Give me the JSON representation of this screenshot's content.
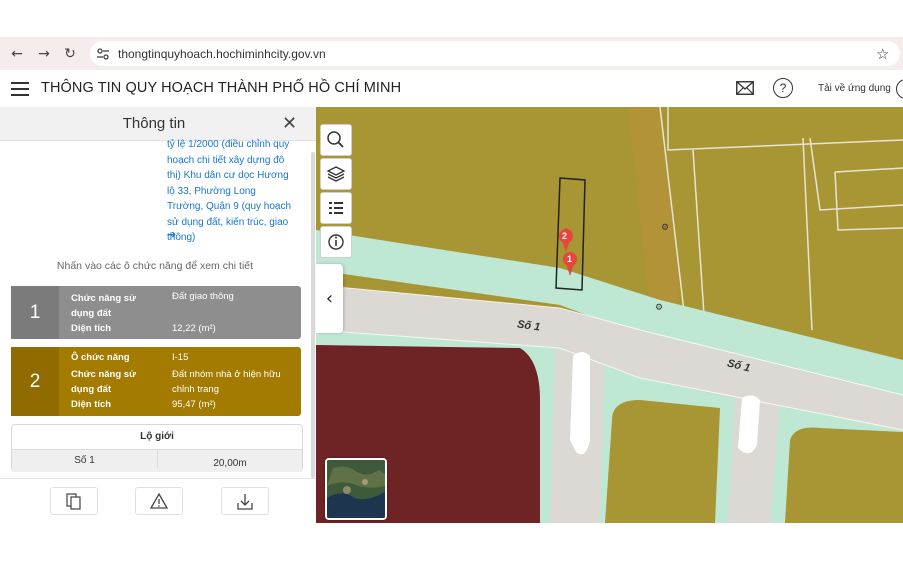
{
  "browser": {
    "url": "thongtinquyhoach.hochiminhcity.gov.vn"
  },
  "header": {
    "title": "THÔNG TIN QUY HOẠCH THÀNH PHỐ HỒ CHÍ MINH",
    "download_app": "Tải về ứng dụng"
  },
  "panel": {
    "title": "Thông tin",
    "plan_link": "tỷ lệ 1/2000 (điều chỉnh quy hoạch chi tiết xây dựng đô thị) Khu dân cư dọc Hương lộ 33, Phường Long Trường, Quận 9 (quy hoạch sử dụng đất, kiến trúc, giao thông)",
    "hint": "Nhấn vào các ô chức năng để xem chi tiết",
    "zones": [
      {
        "number": "1",
        "function_label": "Chức năng sử dụng đất",
        "function_value": "Đất giao thông",
        "area_label": "Diện tích",
        "area_value": "12,22 (m²)",
        "color": "#8e8e8e"
      },
      {
        "number": "2",
        "cell_label": "Ô chức năng",
        "cell_value": "I-15",
        "function_label": "Chức năng sử dụng đất",
        "function_value": "Đất nhóm nhà ở hiện hữu chỉnh trang",
        "area_label": "Diện tích",
        "area_value": "95,47 (m²)",
        "color": "#a27b00"
      }
    ],
    "logioi": {
      "title": "Lộ giới",
      "road": "Số 1",
      "width": "20,00m"
    }
  },
  "map": {
    "road_label_1": "Số 1",
    "road_label_2": "Số 1",
    "marker_1": "1",
    "marker_2": "2",
    "colors": {
      "residential": "#a89534",
      "road": "#dcd9d4",
      "green": "#bfe8d4",
      "commercial": "#6e2424"
    }
  }
}
